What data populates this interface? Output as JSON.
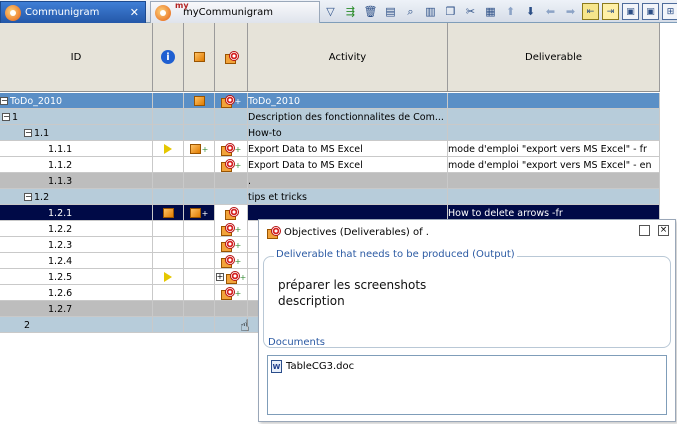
{
  "tabs": [
    {
      "label": "Communigram",
      "active": true
    },
    {
      "label": "myCommunigram",
      "badge": "my",
      "active": false
    }
  ],
  "grid": {
    "headers": {
      "id": "ID",
      "activity": "Activity",
      "deliverable": "Deliverable"
    },
    "rows": [
      {
        "id": "ToDo_2010",
        "activity": "ToDo_2010",
        "deliverable": ""
      },
      {
        "id": "1",
        "activity": "Description des fonctionnalites de Com...",
        "deliverable": ""
      },
      {
        "id": "1.1",
        "activity": "How-to",
        "deliverable": ""
      },
      {
        "id": "1.1.1",
        "activity": "Export Data to MS Excel",
        "deliverable": "mode d'emploi \"export vers MS Excel\" - fr"
      },
      {
        "id": "1.1.2",
        "activity": "Export Data to MS Excel",
        "deliverable": "mode d'emploi \"export vers MS Excel\" - en"
      },
      {
        "id": "1.1.3",
        "activity": ".",
        "deliverable": ""
      },
      {
        "id": "1.2",
        "activity": "tips et tricks",
        "deliverable": ""
      },
      {
        "id": "1.2.1",
        "activity": "",
        "deliverable": "How to delete arrows -fr"
      },
      {
        "id": "1.2.2",
        "activity": "",
        "deliverable": ""
      },
      {
        "id": "1.2.3",
        "activity": "",
        "deliverable": ""
      },
      {
        "id": "1.2.4",
        "activity": "",
        "deliverable": ""
      },
      {
        "id": "1.2.5",
        "activity": "",
        "deliverable": ""
      },
      {
        "id": "1.2.6",
        "activity": "",
        "deliverable": ""
      },
      {
        "id": "1.2.7",
        "activity": "",
        "deliverable": ""
      },
      {
        "id": "2",
        "activity": "",
        "deliverable": ""
      }
    ]
  },
  "popup": {
    "title": "Objectives (Deliverables) of  .",
    "output_legend": "Deliverable that needs to be produced (Output)",
    "output_lines": [
      "préparer les screenshots",
      "description"
    ],
    "documents_label": "Documents",
    "documents": [
      "TableCG3.doc"
    ]
  }
}
